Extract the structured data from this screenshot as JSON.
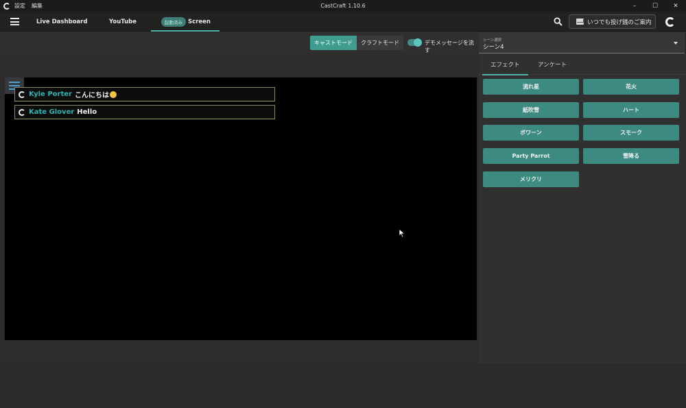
{
  "titlebar": {
    "menu": [
      "設定",
      "編集"
    ],
    "title": "CastCraft 1.10.6",
    "controls": [
      "–",
      "☐",
      "✕"
    ]
  },
  "nav": {
    "tabs": [
      {
        "label": "Live Dashboard"
      },
      {
        "label": "YouTube"
      },
      {
        "label": "Screen",
        "badge": "起動済み"
      }
    ],
    "guide_button": "いつでも投げ銭のご案内"
  },
  "toolbar": {
    "cast_mode": "キャストモード",
    "craft_mode": "クラフトモード",
    "demo_toggle_label": "デモメッセージを流す",
    "demo_toggle_on": true
  },
  "scene_select": {
    "label": "シーン選択",
    "value": "シーン4"
  },
  "chat": [
    {
      "author": "Kyle Porter",
      "message": "こんにちは",
      "emoji": "smile"
    },
    {
      "author": "Kate Glover",
      "message": "Hello"
    }
  ],
  "panel": {
    "tabs": [
      "エフェクト",
      "アンケート"
    ],
    "effects": [
      "流れ星",
      "花火",
      "紙吹雪",
      "ハート",
      "ボワーン",
      "スモーク",
      "Party Parrot",
      "雪降る",
      "メリクリ"
    ]
  },
  "colors": {
    "accent": "#3f9c8f",
    "author": "#2fb3b3",
    "background": "#2b2b2b"
  }
}
